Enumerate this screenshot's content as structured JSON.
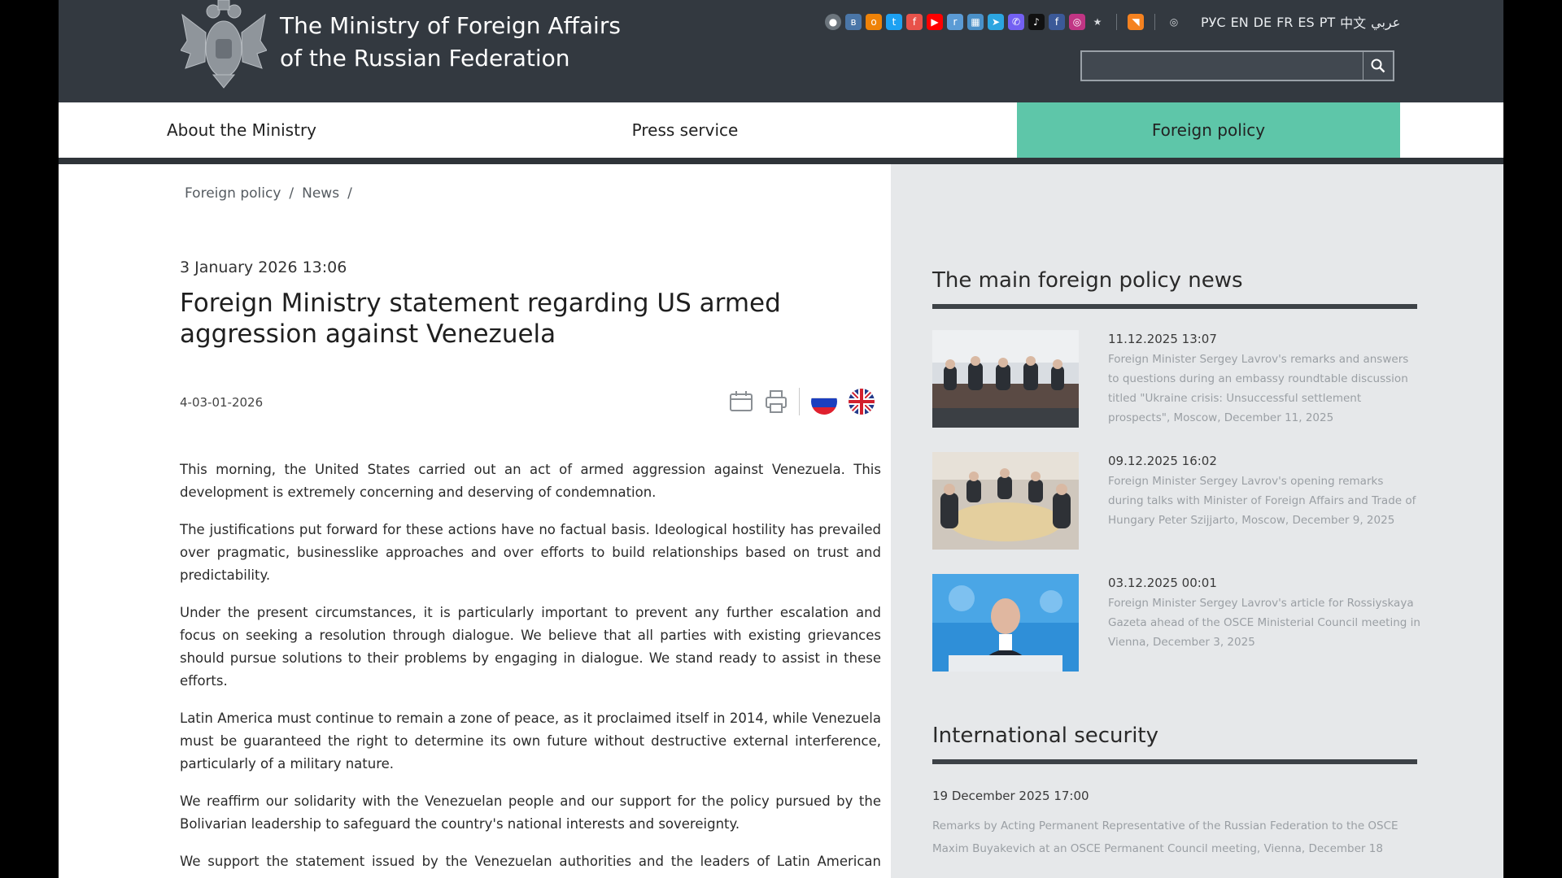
{
  "header": {
    "title_line1": "The Ministry of Foreign Affairs",
    "title_line2": "of the Russian Federation",
    "languages": [
      "РУС",
      "EN",
      "DE",
      "FR",
      "ES",
      "PT",
      "中文",
      "عربي"
    ],
    "search_placeholder": ""
  },
  "nav": {
    "items": [
      {
        "label": "About the Ministry"
      },
      {
        "label": "Press service"
      },
      {
        "label": "Foreign policy"
      }
    ],
    "active_color": "#5ec6a9"
  },
  "breadcrumb": [
    "Foreign policy",
    "/",
    "News",
    "/"
  ],
  "article": {
    "date": "3 January 2026 13:06",
    "title": "Foreign Ministry statement regarding US armed aggression against Venezuela",
    "doc_number": "4-03-01-2026",
    "paragraphs": [
      "This morning, the United States carried out an act of armed aggression against Venezuela. This development is extremely concerning and deserving of condemnation.",
      "The justifications put forward for these actions have no factual basis. Ideological hostility has prevailed over pragmatic, businesslike approaches and over efforts to build relationships based on trust and predictability.",
      "Under the present circumstances, it is particularly important to prevent any further escalation and focus on seeking a resolution through dialogue. We believe that all parties with existing grievances should pursue solutions to their problems by engaging in dialogue. We stand ready to assist in these efforts.",
      "Latin America must continue to remain a zone of peace, as it proclaimed itself in 2014, while Venezuela must be guaranteed the right to determine its own future without destructive external interference, particularly of a military nature.",
      "We reaffirm our solidarity with the Venezuelan people and our support for the policy pursued by the Bolivarian leadership to safeguard the country's national interests and sovereignty.",
      "We support the statement issued by the Venezuelan authorities and the leaders of Latin American countries calling for an urgent meeting of the UN Security Council."
    ]
  },
  "sidebar": {
    "main_news_heading": "The main foreign policy news",
    "news": [
      {
        "date": "11.12.2025 13:07",
        "title": "Foreign Minister Sergey Lavrov's remarks and answers to questions during an embassy roundtable discussion titled \"Ukraine crisis: Unsuccessful settlement prospects\", Moscow, December 11, 2025"
      },
      {
        "date": "09.12.2025 16:02",
        "title": "Foreign Minister Sergey Lavrov's opening remarks during talks with Minister of Foreign Affairs and Trade of Hungary Peter Szijjarto, Moscow, December 9, 2025"
      },
      {
        "date": "03.12.2025 00:01",
        "title": "Foreign Minister Sergey Lavrov's article for Rossiyskaya Gazeta ahead of the OSCE Ministerial Council meeting in Vienna, December 3, 2025"
      }
    ],
    "security_heading": "International security",
    "security_date": "19 December 2025 17:00",
    "security_text": "Remarks by Acting Permanent Representative of the Russian Federation to the OSCE Maxim Buyakevich at an OSCE Permanent Council meeting, Vienna, December 18"
  }
}
